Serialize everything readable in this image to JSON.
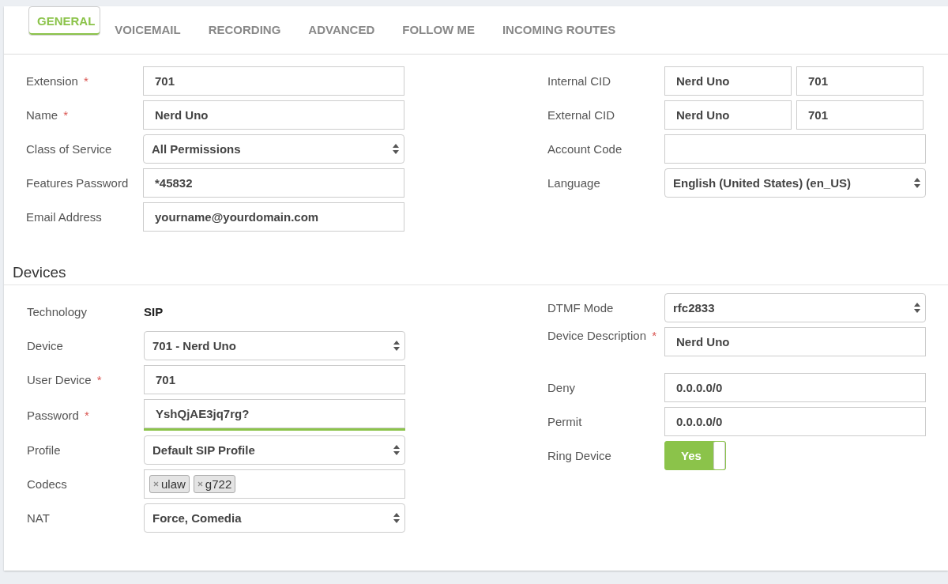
{
  "tabs": [
    {
      "label": "GENERAL",
      "selected": true
    },
    {
      "label": "VOICEMAIL",
      "selected": false
    },
    {
      "label": "RECORDING",
      "selected": false
    },
    {
      "label": "ADVANCED",
      "selected": false
    },
    {
      "label": "FOLLOW ME",
      "selected": false
    },
    {
      "label": "INCOMING ROUTES",
      "selected": false
    }
  ],
  "general": {
    "left": [
      {
        "label": "Extension",
        "required_mark": "*",
        "kind": "input",
        "value": "701"
      },
      {
        "label": "Name",
        "required_mark": "*",
        "kind": "input",
        "value": "Nerd Uno"
      },
      {
        "label": "Class of Service",
        "kind": "select",
        "value": "All Permissions"
      },
      {
        "label": "Features Password",
        "kind": "input",
        "value": "*45832"
      },
      {
        "label": "Email Address",
        "kind": "input",
        "value": "yourname@yourdomain.com"
      }
    ],
    "right": [
      {
        "label": "Internal CID",
        "kind": "pair",
        "values": [
          "Nerd Uno",
          "701"
        ]
      },
      {
        "label": "External CID",
        "kind": "pair",
        "values": [
          "Nerd Uno",
          "701"
        ]
      },
      {
        "label": "Account Code",
        "kind": "input"
      },
      {
        "label": "Language",
        "kind": "select",
        "value": "English (United States) (en_US)"
      }
    ]
  },
  "devices": {
    "heading": "Devices",
    "left": [
      {
        "label": "Technology",
        "kind": "static",
        "value": "SIP"
      },
      {
        "label": "Device",
        "kind": "select",
        "value": "701 - Nerd Uno"
      },
      {
        "label": "User Device",
        "required_mark": "*",
        "kind": "input",
        "value": "701"
      },
      {
        "label": "Password",
        "required_mark": "*",
        "kind": "password",
        "value": "YshQjAE3jq7rg?",
        "level": 1
      },
      {
        "label": "Profile",
        "kind": "select",
        "value": "Default SIP Profile"
      },
      {
        "label": "Codecs",
        "kind": "tags",
        "values": [
          "ulaw",
          "g722"
        ]
      },
      {
        "label": "NAT",
        "kind": "select",
        "value": "Force, Comedia"
      }
    ],
    "right": [
      {
        "label": "DTMF Mode",
        "kind": "select",
        "value": "rfc2833"
      },
      {
        "label": "Device Description",
        "required_mark": "*",
        "kind": "input",
        "value": "Nerd Uno"
      },
      {
        "label": "Deny",
        "kind": "input",
        "value": "0.0.0.0/0"
      },
      {
        "label": "Permit",
        "kind": "input",
        "value": "0.0.0.0/0"
      },
      {
        "label": "Ring Device",
        "kind": "toggle",
        "on": true,
        "value": "Yes"
      }
    ]
  }
}
